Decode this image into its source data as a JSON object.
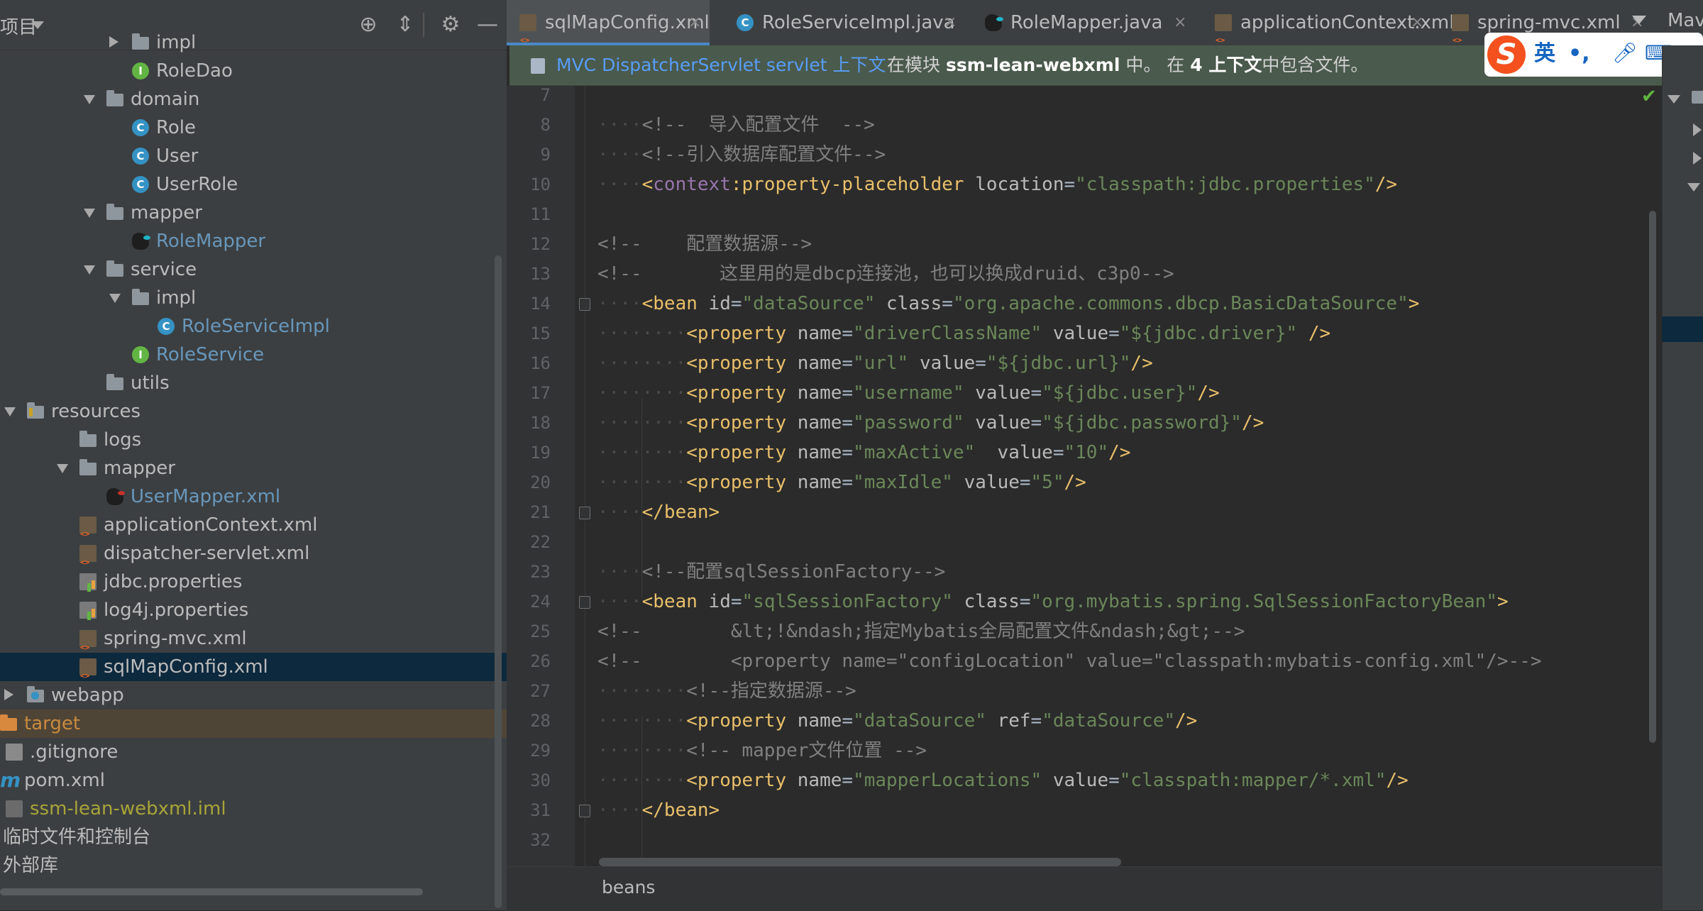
{
  "project_panel": {
    "title": "项目",
    "tree": [
      {
        "label": "impl",
        "icon": "folder-icon",
        "arrow": "right"
      },
      {
        "label": "RoleDao",
        "icon": "interface-icon",
        "color": "normal"
      },
      {
        "label": "domain",
        "icon": "package-icon",
        "arrow": "down"
      },
      {
        "label": "Role",
        "icon": "class-icon",
        "color": "normal"
      },
      {
        "label": "User",
        "icon": "class-icon",
        "color": "normal"
      },
      {
        "label": "UserRole",
        "icon": "class-icon",
        "color": "normal"
      },
      {
        "label": "mapper",
        "icon": "package-icon",
        "arrow": "down"
      },
      {
        "label": "RoleMapper",
        "icon": "mybatis-icon",
        "color": "blue"
      },
      {
        "label": "service",
        "icon": "package-icon",
        "arrow": "down"
      },
      {
        "label": "impl",
        "icon": "package-icon",
        "arrow": "down"
      },
      {
        "label": "RoleServiceImpl",
        "icon": "class-icon",
        "color": "blue"
      },
      {
        "label": "RoleService",
        "icon": "interface-icon",
        "color": "blue"
      },
      {
        "label": "utils",
        "icon": "package-icon"
      },
      {
        "label": "resources",
        "icon": "resources-folder-icon",
        "arrow": "down"
      },
      {
        "label": "logs",
        "icon": "folder-icon"
      },
      {
        "label": "mapper",
        "icon": "folder-icon",
        "arrow": "down"
      },
      {
        "label": "UserMapper.xml",
        "icon": "mybatis-xml-icon",
        "color": "blue"
      },
      {
        "label": "applicationContext.xml",
        "icon": "spring-xml-icon",
        "color": "normal"
      },
      {
        "label": "dispatcher-servlet.xml",
        "icon": "spring-xml-icon",
        "color": "normal"
      },
      {
        "label": "jdbc.properties",
        "icon": "properties-icon",
        "color": "normal"
      },
      {
        "label": "log4j.properties",
        "icon": "properties-icon",
        "color": "normal"
      },
      {
        "label": "spring-mvc.xml",
        "icon": "spring-xml-icon",
        "color": "normal"
      },
      {
        "label": "sqlMapConfig.xml",
        "icon": "spring-xml-icon",
        "color": "normal",
        "selected": true
      },
      {
        "label": "webapp",
        "icon": "web-folder-icon",
        "arrow": "right"
      },
      {
        "label": "target",
        "icon": "excluded-folder-icon",
        "color": "orange",
        "excluded": true
      },
      {
        "label": ".gitignore",
        "icon": "gitignore-icon",
        "color": "normal"
      },
      {
        "label": "pom.xml",
        "icon": "maven-icon",
        "color": "normal"
      },
      {
        "label": "ssm-lean-webxml.iml",
        "icon": "iml-icon",
        "color": "olive"
      },
      {
        "label": "临时文件和控制台",
        "icon": "none",
        "color": "normal"
      },
      {
        "label": "外部库",
        "icon": "none",
        "color": "normal"
      }
    ]
  },
  "tabs": [
    {
      "label": "sqlMapConfig.xml",
      "icon": "spring-xml-icon",
      "active": true
    },
    {
      "label": "RoleServiceImpl.java",
      "icon": "class-icon",
      "active": false
    },
    {
      "label": "RoleMapper.java",
      "icon": "mybatis-icon",
      "active": false
    },
    {
      "label": "applicationContext.xml",
      "icon": "spring-xml-icon",
      "active": false
    },
    {
      "label": "spring-mvc.xml",
      "icon": "spring-xml-icon",
      "active": false
    }
  ],
  "notification": {
    "link": "MVC DispatcherServlet servlet 上下文",
    "msg_pre": "在模块 ",
    "module": "ssm-lean-webxml",
    "msg_mid": " 中。 在 ",
    "count": "4",
    "context_word": " 上下文",
    "msg_post": "中包含文件。"
  },
  "ime": {
    "lang": "英",
    "punct": "•,"
  },
  "right_panel": {
    "label": "Mav"
  },
  "editor": {
    "lines": [
      {
        "n": "7",
        "tokens": []
      },
      {
        "n": "8",
        "tokens": [
          [
            "dot",
            "····"
          ],
          [
            "cmt",
            "<!--  导入配置文件  -->"
          ]
        ]
      },
      {
        "n": "9",
        "tokens": [
          [
            "dot",
            "····"
          ],
          [
            "cmt",
            "<!--引入数据库配置文件-->"
          ]
        ]
      },
      {
        "n": "10",
        "tokens": [
          [
            "dot",
            "····"
          ],
          [
            "tag",
            "<"
          ],
          [
            "ns",
            "context"
          ],
          [
            "tag",
            ":property-placeholder"
          ],
          [
            "attr",
            " location"
          ],
          [
            "plain",
            "="
          ],
          [
            "val",
            "\"classpath:jdbc.properties\""
          ],
          [
            "tag",
            "/>"
          ]
        ]
      },
      {
        "n": "11",
        "tokens": []
      },
      {
        "n": "12",
        "tokens": [
          [
            "cmt",
            "<!--    配置数据源-->"
          ]
        ]
      },
      {
        "n": "13",
        "tokens": [
          [
            "cmt",
            "<!--       这里用的是dbcp连接池，也可以换成druid、c3p0-->"
          ]
        ]
      },
      {
        "n": "14",
        "tokens": [
          [
            "dot",
            "····"
          ],
          [
            "tag",
            "<bean"
          ],
          [
            "attr",
            " id"
          ],
          [
            "plain",
            "="
          ],
          [
            "val",
            "\"dataSource\""
          ],
          [
            "attr",
            " class"
          ],
          [
            "plain",
            "="
          ],
          [
            "val",
            "\"org.apache.commons.dbcp.BasicDataSource\""
          ],
          [
            "tag",
            ">"
          ]
        ]
      },
      {
        "n": "15",
        "tokens": [
          [
            "dot",
            "········"
          ],
          [
            "tag",
            "<property"
          ],
          [
            "attr",
            " name"
          ],
          [
            "plain",
            "="
          ],
          [
            "val",
            "\"driverClassName\""
          ],
          [
            "attr",
            " value"
          ],
          [
            "plain",
            "="
          ],
          [
            "val",
            "\"${jdbc.driver}\""
          ],
          [
            "tag",
            " />"
          ]
        ]
      },
      {
        "n": "16",
        "tokens": [
          [
            "dot",
            "········"
          ],
          [
            "tag",
            "<property"
          ],
          [
            "attr",
            " name"
          ],
          [
            "plain",
            "="
          ],
          [
            "val",
            "\"url\""
          ],
          [
            "attr",
            " value"
          ],
          [
            "plain",
            "="
          ],
          [
            "val",
            "\"${jdbc.url}\""
          ],
          [
            "tag",
            "/>"
          ]
        ]
      },
      {
        "n": "17",
        "tokens": [
          [
            "dot",
            "········"
          ],
          [
            "tag",
            "<property"
          ],
          [
            "attr",
            " name"
          ],
          [
            "plain",
            "="
          ],
          [
            "val",
            "\"username\""
          ],
          [
            "attr",
            " value"
          ],
          [
            "plain",
            "="
          ],
          [
            "val",
            "\"${jdbc.user}\""
          ],
          [
            "tag",
            "/>"
          ]
        ]
      },
      {
        "n": "18",
        "tokens": [
          [
            "dot",
            "········"
          ],
          [
            "tag",
            "<property"
          ],
          [
            "attr",
            " name"
          ],
          [
            "plain",
            "="
          ],
          [
            "val",
            "\"password\""
          ],
          [
            "attr",
            " value"
          ],
          [
            "plain",
            "="
          ],
          [
            "val",
            "\"${jdbc.password}\""
          ],
          [
            "tag",
            "/>"
          ]
        ]
      },
      {
        "n": "19",
        "tokens": [
          [
            "dot",
            "········"
          ],
          [
            "tag",
            "<property"
          ],
          [
            "attr",
            " name"
          ],
          [
            "plain",
            "="
          ],
          [
            "val",
            "\"maxActive\""
          ],
          [
            "attr",
            "  value"
          ],
          [
            "plain",
            "="
          ],
          [
            "val",
            "\"10\""
          ],
          [
            "tag",
            "/>"
          ]
        ]
      },
      {
        "n": "20",
        "tokens": [
          [
            "dot",
            "········"
          ],
          [
            "tag",
            "<property"
          ],
          [
            "attr",
            " name"
          ],
          [
            "plain",
            "="
          ],
          [
            "val",
            "\"maxIdle\""
          ],
          [
            "attr",
            " value"
          ],
          [
            "plain",
            "="
          ],
          [
            "val",
            "\"5\""
          ],
          [
            "tag",
            "/>"
          ]
        ]
      },
      {
        "n": "21",
        "tokens": [
          [
            "dot",
            "····"
          ],
          [
            "tag",
            "</bean>"
          ]
        ]
      },
      {
        "n": "22",
        "tokens": []
      },
      {
        "n": "23",
        "tokens": [
          [
            "dot",
            "····"
          ],
          [
            "cmt",
            "<!--配置sqlSessionFactory-->"
          ]
        ]
      },
      {
        "n": "24",
        "tokens": [
          [
            "dot",
            "····"
          ],
          [
            "tag",
            "<bean"
          ],
          [
            "attr",
            " id"
          ],
          [
            "plain",
            "="
          ],
          [
            "val",
            "\"sqlSessionFactory\""
          ],
          [
            "attr",
            " class"
          ],
          [
            "plain",
            "="
          ],
          [
            "val",
            "\"org.mybatis.spring.SqlSessionFactoryBean\""
          ],
          [
            "tag",
            ">"
          ]
        ]
      },
      {
        "n": "25",
        "tokens": [
          [
            "cmt",
            "<!--        &lt;!&ndash;指定Mybatis全局配置文件&ndash;&gt;-->"
          ]
        ]
      },
      {
        "n": "26",
        "tokens": [
          [
            "cmt",
            "<!--        <property name=\"configLocation\" value=\"classpath:mybatis-config.xml\"/>-->"
          ]
        ]
      },
      {
        "n": "27",
        "tokens": [
          [
            "dot",
            "········"
          ],
          [
            "cmt",
            "<!--指定数据源-->"
          ]
        ]
      },
      {
        "n": "28",
        "tokens": [
          [
            "dot",
            "········"
          ],
          [
            "tag",
            "<property"
          ],
          [
            "attr",
            " name"
          ],
          [
            "plain",
            "="
          ],
          [
            "val",
            "\"dataSource\""
          ],
          [
            "attr",
            " ref"
          ],
          [
            "plain",
            "="
          ],
          [
            "val",
            "\"dataSource\""
          ],
          [
            "tag",
            "/>"
          ]
        ]
      },
      {
        "n": "29",
        "tokens": [
          [
            "dot",
            "········"
          ],
          [
            "cmt",
            "<!-- mapper文件位置 -->"
          ]
        ]
      },
      {
        "n": "30",
        "tokens": [
          [
            "dot",
            "········"
          ],
          [
            "tag",
            "<property"
          ],
          [
            "attr",
            " name"
          ],
          [
            "plain",
            "="
          ],
          [
            "val",
            "\"mapperLocations\""
          ],
          [
            "attr",
            " value"
          ],
          [
            "plain",
            "="
          ],
          [
            "val",
            "\"classpath:mapper/*.xml\""
          ],
          [
            "tag",
            "/>"
          ]
        ]
      },
      {
        "n": "31",
        "tokens": [
          [
            "dot",
            "····"
          ],
          [
            "tag",
            "</bean>"
          ]
        ]
      },
      {
        "n": "32",
        "tokens": []
      }
    ],
    "fold_lines": [
      "14",
      "21",
      "24",
      "31"
    ]
  },
  "breadcrumb": {
    "text": "beans"
  },
  "colors": {
    "tag": "#e8bf6a",
    "namespace": "#9876aa",
    "attribute": "#bababa",
    "value": "#6a8759",
    "comment": "#808080",
    "link": "#589df6"
  }
}
